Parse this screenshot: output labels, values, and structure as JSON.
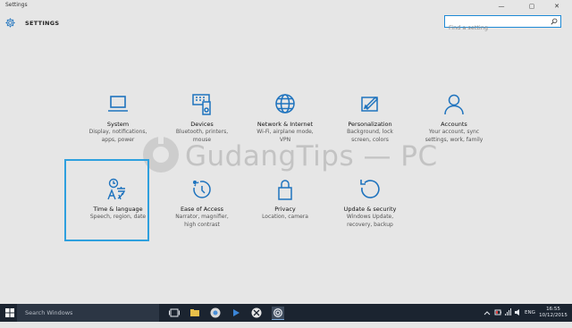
{
  "window": {
    "title": "Settings",
    "minimize": "—",
    "maximize": "▢",
    "close": "✕"
  },
  "header": {
    "title": "SETTINGS"
  },
  "search": {
    "placeholder": "Find a setting"
  },
  "tiles": [
    {
      "name": "System",
      "desc_line1": "Display, notifications,",
      "desc_line2": "apps, power",
      "desc_line3": "",
      "icon": "laptop-icon"
    },
    {
      "name": "Devices",
      "desc_line1": "Bluetooth, printers,",
      "desc_line2": "mouse",
      "desc_line3": "",
      "icon": "devices-icon"
    },
    {
      "name": "Network & Internet",
      "desc_line1": "Wi-Fi, airplane mode,",
      "desc_line2": "VPN",
      "desc_line3": "",
      "icon": "globe-icon"
    },
    {
      "name": "Personalization",
      "desc_line1": "Background, lock",
      "desc_line2": "screen, colors",
      "desc_line3": "",
      "icon": "paint-icon"
    },
    {
      "name": "Accounts",
      "desc_line1": "Your account, sync",
      "desc_line2": "settings, work, family",
      "desc_line3": "",
      "icon": "person-icon"
    },
    {
      "name": "Time & language",
      "desc_line1": "Speech, region, date",
      "desc_line2": "",
      "desc_line3": "",
      "icon": "time-language-icon"
    },
    {
      "name": "Ease of Access",
      "desc_line1": "Narrator, magnifier,",
      "desc_line2": "high contrast",
      "desc_line3": "",
      "icon": "ease-of-access-icon"
    },
    {
      "name": "Privacy",
      "desc_line1": "Location, camera",
      "desc_line2": "",
      "desc_line3": "",
      "icon": "lock-icon"
    },
    {
      "name": "Update & security",
      "desc_line1": "Windows Update,",
      "desc_line2": "recovery, backup",
      "desc_line3": "",
      "icon": "refresh-icon"
    }
  ],
  "watermark": {
    "text": "GudangTips — PC"
  },
  "taskbar": {
    "search_text": "Search Windows",
    "language": "ENG",
    "time": "16:55",
    "date": "10/12/2015"
  },
  "colors": {
    "accent": "#1e73be",
    "selection": "#2ea0de",
    "taskbar": "#1b2430"
  }
}
